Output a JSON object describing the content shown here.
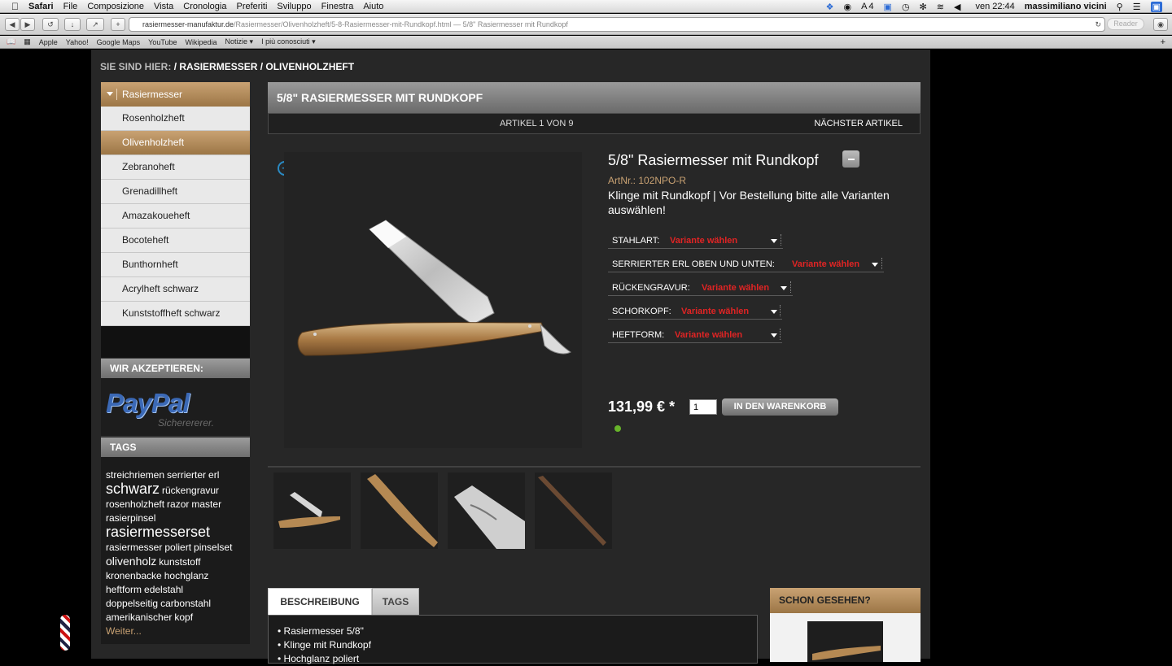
{
  "menubar": {
    "app": "Safari",
    "menus": [
      "File",
      "Composizione",
      "Vista",
      "Cronologia",
      "Preferiti",
      "Sviluppo",
      "Finestra",
      "Aiuto"
    ],
    "status_items": [
      "4"
    ],
    "clock": "ven 22:44",
    "user": "massimiliano vicini"
  },
  "browser": {
    "url_host": "rasiermesser-manufaktur.de",
    "url_path": "/Rasiermesser/Olivenholzheft/5-8-Rasiermesser-mit-Rundkopf.html — 5/8\" Rasiermesser mit Rundkopf",
    "reader_label": "Reader",
    "bookmarks": [
      "Apple",
      "Yahoo!",
      "Google Maps",
      "YouTube",
      "Wikipedia",
      "Notizie ▾",
      "I più conosciuti ▾"
    ]
  },
  "breadcrumb": {
    "label": "SIE SIND HIER:",
    "path": "/ RASIERMESSER / OLIVENHOLZHEFT"
  },
  "sidebar": {
    "category_head": "Rasiermesser",
    "items": [
      {
        "label": "Rosenholzheft",
        "active": false
      },
      {
        "label": "Olivenholzheft",
        "active": true
      },
      {
        "label": "Zebranoheft",
        "active": false
      },
      {
        "label": "Grenadillheft",
        "active": false
      },
      {
        "label": "Amazakoueheft",
        "active": false
      },
      {
        "label": "Bocoteheft",
        "active": false
      },
      {
        "label": "Bunthornheft",
        "active": false
      },
      {
        "label": "Acrylheft schwarz",
        "active": false
      },
      {
        "label": "Kunststoffheft schwarz",
        "active": false
      }
    ],
    "accept_head": "WIR AKZEPTIEREN:",
    "paypal_logo": "PayPal",
    "paypal_sub": "Sicherererer.",
    "tags_head": "TAGS",
    "tags": {
      "t1": "streichriemen",
      "t2": "serrierter",
      "t3": "erl",
      "t4": "schwarz",
      "t5": "rückengravur",
      "t6": "rosenholzheft",
      "t7": "razor",
      "t8": "master",
      "t9": "rasierpinsel",
      "t10": "rasiermesserset",
      "t11": "rasiermesser",
      "t12": "poliert",
      "t13": "pinselset",
      "t14": "olivenholz",
      "t15": "kunststoff",
      "t16": "kronenbacke",
      "t17": "hochglanz",
      "t18": "heftform",
      "t19": "edelstahl",
      "t20": "doppelseitig",
      "t21": "carbonstahl",
      "t22": "amerikanischer",
      "t23": "kopf",
      "more": "Weiter..."
    }
  },
  "product": {
    "header_title": "5/8\" RASIERMESSER MIT RUNDKOPF",
    "nav_count": "ARTIKEL 1 VON 9",
    "nav_next": "NÄCHSTER ARTIKEL",
    "title": "5/8\" Rasiermesser mit Rundkopf",
    "artnr_label": "ArtNr.:",
    "artnr_value": "102NPO-R",
    "description": "Klinge mit Rundkopf | Vor Bestellung bitte alle Varianten auswählen!",
    "variants": [
      {
        "label": "STAHLART:",
        "value": "Variante wählen"
      },
      {
        "label": "SERRIERTER ERL OBEN UND UNTEN:",
        "value": "Variante wählen"
      },
      {
        "label": "RÜCKENGRAVUR:",
        "value": "Variante wählen"
      },
      {
        "label": "SCHORKOPF:",
        "value": "Variante wählen"
      },
      {
        "label": "HEFTFORM:",
        "value": "Variante wählen"
      }
    ],
    "price": "131,99 € *",
    "quantity": "1",
    "cart_button": "IN DEN WARENKORB",
    "availability_color": "#67b42a"
  },
  "tabs": {
    "description": "BESCHREIBUNG",
    "tags": "TAGS",
    "bullets": [
      "• Rasiermesser 5/8\"",
      "• Klinge mit Rundkopf",
      "• Hochglanz poliert"
    ]
  },
  "seen": {
    "head": "SCHON GESEHEN?"
  },
  "colors": {
    "accent": "#c9a273",
    "variant_red": "#e02424",
    "page_bg": "#272727"
  }
}
